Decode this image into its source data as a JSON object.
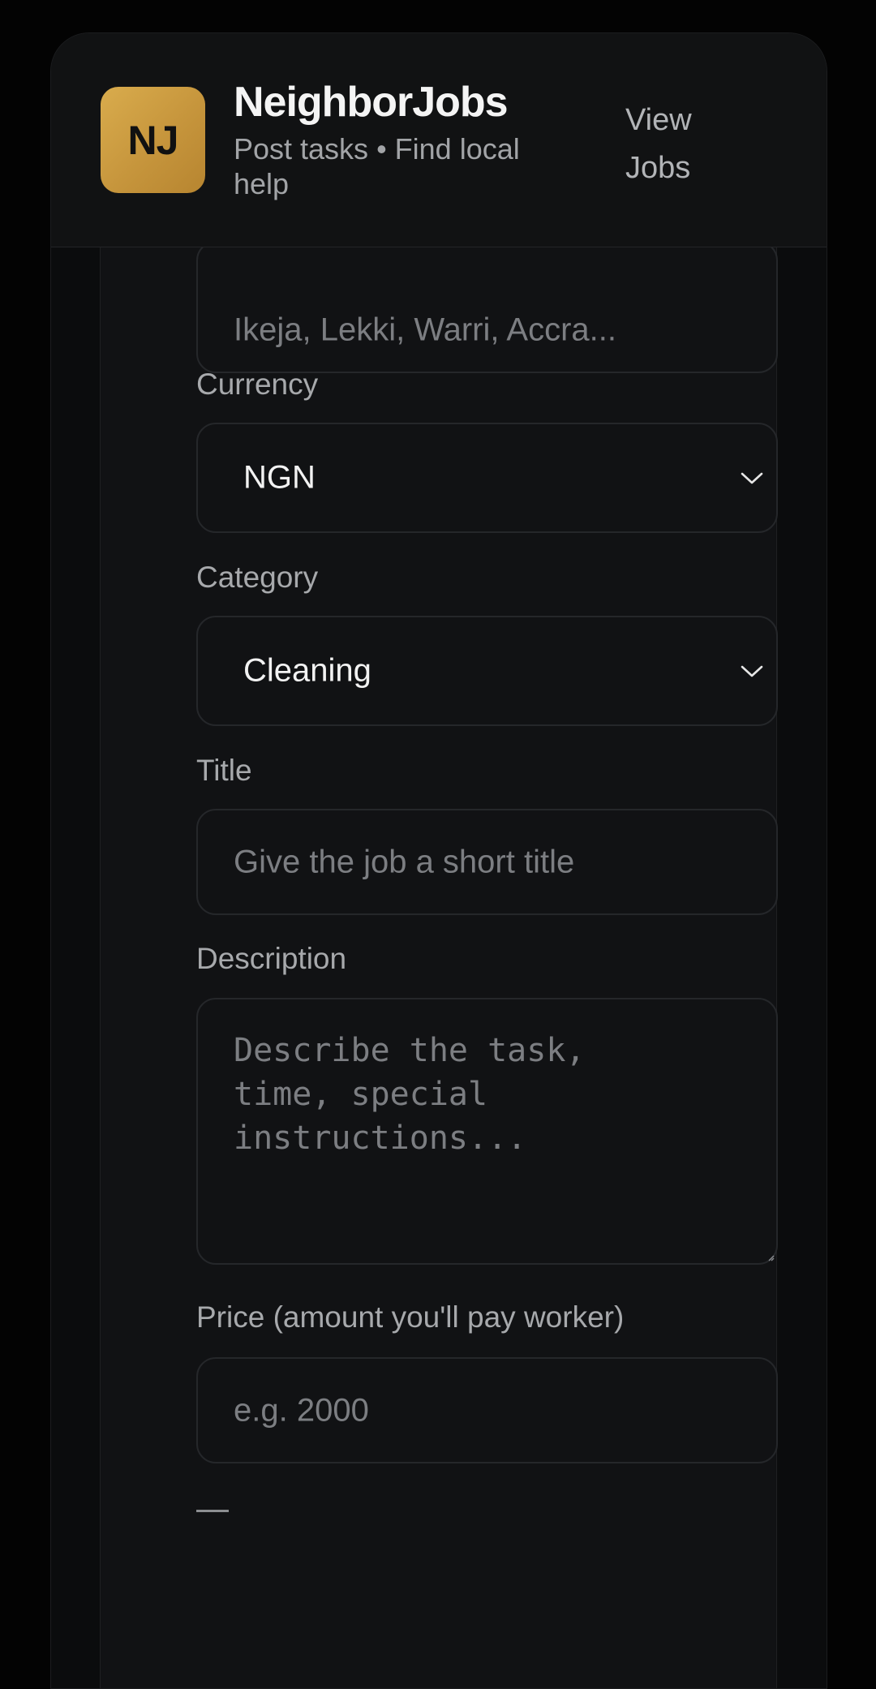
{
  "header": {
    "logo_text": "NJ",
    "title": "NeighborJobs",
    "subtitle": "Post tasks • Find local help",
    "view_jobs_label": "View Jobs"
  },
  "form": {
    "location": {
      "placeholder": "Ikeja, Lekki, Warri, Accra..."
    },
    "currency": {
      "label": "Currency",
      "value": "NGN"
    },
    "category": {
      "label": "Category",
      "value": "Cleaning"
    },
    "title_field": {
      "label": "Title",
      "placeholder": "Give the job a short title"
    },
    "description": {
      "label": "Description",
      "placeholder": "Describe the task, time, special instructions..."
    },
    "price": {
      "label": "Price (amount you'll pay worker)",
      "placeholder": "e.g. 2000"
    },
    "price_preview": "—"
  },
  "icons": {
    "currency_dropdown": "chevron-down-icon",
    "category_dropdown": "chevron-down-icon"
  },
  "colors": {
    "background": "#030303",
    "panel": "#111214",
    "accent": "#d9ac4d"
  }
}
